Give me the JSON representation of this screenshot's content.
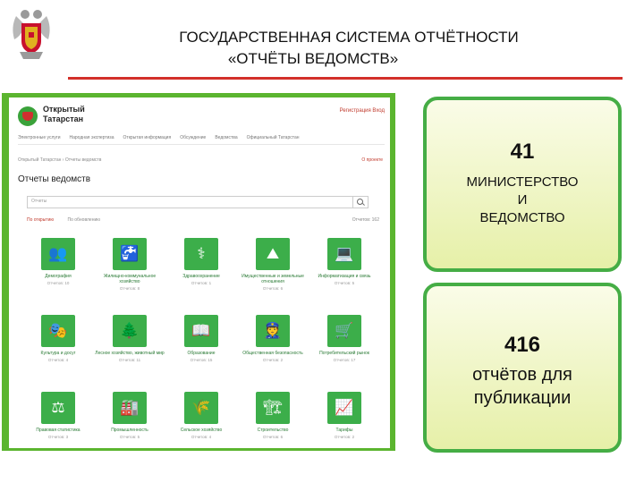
{
  "slide": {
    "title_line1": "ГОСУДАРСТВЕННАЯ СИСТЕМА ОТЧЁТНОСТИ",
    "title_line2": "«ОТЧЁТЫ ВЕДОМСТВ»"
  },
  "site": {
    "brand_line1": "Открытый",
    "brand_line2": "Татарстан",
    "header_links": "Регистрация   Вход",
    "nav": [
      "Электронные услуги",
      "Народная экспертиза",
      "Открытая информация",
      "Обсуждение",
      "Ведомства",
      "Официальный Татарстан"
    ],
    "breadcrumb": "Открытый Татарстан › Отчеты ведомств",
    "about_link": "О проекте",
    "page_title": "Отчеты ведомств",
    "search_placeholder": "Отчеты",
    "sort_active": "По открытию",
    "sort_alt": "По обновлению",
    "reports_count": "Отчетов: 162",
    "categories": [
      {
        "name": "Демография",
        "count": "Отчетов: 10",
        "icon": "people-icon",
        "glyph": "👥"
      },
      {
        "name": "Жилищно-коммунальное хозяйство",
        "count": "Отчетов: 8",
        "icon": "faucet-icon",
        "glyph": "🚰"
      },
      {
        "name": "Здравоохранение",
        "count": "Отчетов: 1",
        "icon": "caduceus-icon",
        "glyph": "⚕"
      },
      {
        "name": "Имущественные и земельные отношения",
        "count": "Отчетов: 6",
        "icon": "land-icon",
        "glyph": "⛰"
      },
      {
        "name": "Информатизация и связь",
        "count": "Отчетов: 5",
        "icon": "laptop-icon",
        "glyph": "💻"
      },
      {
        "name": "Культура и досуг",
        "count": "Отчетов: 4",
        "icon": "theater-icon",
        "glyph": "🎭"
      },
      {
        "name": "Лесное хозяйство, животный мир",
        "count": "Отчетов: 11",
        "icon": "forest-icon",
        "glyph": "🌲"
      },
      {
        "name": "Образование",
        "count": "Отчетов: 15",
        "icon": "book-icon",
        "glyph": "📖"
      },
      {
        "name": "Общественная безопасность",
        "count": "Отчетов: 2",
        "icon": "guard-icon",
        "glyph": "👮"
      },
      {
        "name": "Потребительский рынок",
        "count": "Отчетов: 17",
        "icon": "cart-icon",
        "glyph": "🛒"
      },
      {
        "name": "Правовая статистика",
        "count": "Отчетов: 3",
        "icon": "scales-icon",
        "glyph": "⚖"
      },
      {
        "name": "Промышленность",
        "count": "Отчетов: 5",
        "icon": "factory-icon",
        "glyph": "🏭"
      },
      {
        "name": "Сельское хозяйство",
        "count": "Отчетов: 4",
        "icon": "wheat-icon",
        "glyph": "🌾"
      },
      {
        "name": "Строительство",
        "count": "Отчетов: 6",
        "icon": "crane-icon",
        "glyph": "🏗"
      },
      {
        "name": "Тарифы",
        "count": "Отчетов: 2",
        "icon": "chart-icon",
        "glyph": "📈"
      }
    ]
  },
  "stats": {
    "ministries_number": "41",
    "ministries_label": "МИНИСТЕРСТВО И ВЕДОМСТВО",
    "reports_number": "416",
    "reports_label": "отчётов для публикации"
  },
  "colors": {
    "accent_red": "#d3302a",
    "tile_green": "#3cae4a",
    "card_border": "#45ad45"
  }
}
